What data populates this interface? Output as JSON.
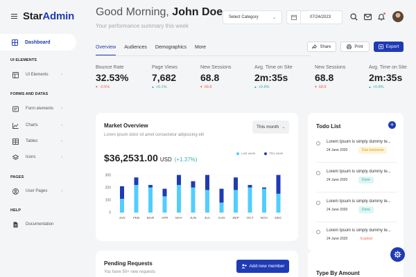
{
  "brand": {
    "part1": "Star",
    "part2": "Admin"
  },
  "sidebar": {
    "active": {
      "label": "Dashboard",
      "icon": "grid-icon"
    },
    "sections": [
      {
        "title": "UI ELEMENTS",
        "items": [
          {
            "label": "UI Elements",
            "icon": "layout-icon",
            "chevron": true
          }
        ]
      },
      {
        "title": "FORMS AND DATAS",
        "items": [
          {
            "label": "Form elements",
            "icon": "card-text-icon",
            "chevron": true
          },
          {
            "label": "Charts",
            "icon": "chart-line-icon",
            "chevron": true
          },
          {
            "label": "Tables",
            "icon": "table-icon",
            "chevron": true
          },
          {
            "label": "Icons",
            "icon": "layers-icon",
            "chevron": true
          }
        ]
      },
      {
        "title": "PAGES",
        "items": [
          {
            "label": "User Pages",
            "icon": "user-icon",
            "chevron": true
          }
        ]
      },
      {
        "title": "HELP",
        "items": [
          {
            "label": "Documentation",
            "icon": "file-icon",
            "chevron": false
          }
        ]
      }
    ]
  },
  "header": {
    "greeting": "Good Morning,",
    "name": "John Doe",
    "subtitle": "Your performance summary this week",
    "category_select": "Select Category",
    "date": "07/24/2023"
  },
  "tabs": [
    "Overview",
    "Audiences",
    "Demographics",
    "More"
  ],
  "actions": {
    "share": "Share",
    "print": "Print",
    "export": "Export"
  },
  "stats": [
    {
      "label": "Bounce Rate",
      "value": "32.53%",
      "change": "-0.5%",
      "dir": "down"
    },
    {
      "label": "Page Views",
      "value": "7,682",
      "change": "+0.1%",
      "dir": "up"
    },
    {
      "label": "New Sessions",
      "value": "68.8",
      "change": "68.8",
      "dir": "down"
    },
    {
      "label": "Avg. Time on Site",
      "value": "2m:35s",
      "change": "+0.8%",
      "dir": "up"
    },
    {
      "label": "New Sessions",
      "value": "68.8",
      "change": "68.8",
      "dir": "down"
    },
    {
      "label": "Avg. Time on Site",
      "value": "2m:35s",
      "change": "+0.8%",
      "dir": "up"
    }
  ],
  "market": {
    "title": "Market Overview",
    "subtitle": "Lorem ipsum dolor sit amet consectetur adipisicing elit",
    "period": "This month",
    "amount": "$36,2531.00",
    "currency": "USD",
    "change": "(+1.37%)"
  },
  "chart_data": {
    "type": "bar",
    "stacked": true,
    "categories": [
      "JAN",
      "FEB",
      "MAR",
      "APR",
      "MAY",
      "JUN",
      "JUL",
      "AUG",
      "SEP",
      "OCT",
      "NOV",
      "DEC"
    ],
    "series": [
      {
        "name": "Last week",
        "color": "#52cdff",
        "values": [
          110,
          220,
          200,
          130,
          220,
          200,
          180,
          80,
          180,
          200,
          190,
          150
        ]
      },
      {
        "name": "This week",
        "color": "#1f3bb3",
        "values": [
          100,
          60,
          20,
          60,
          80,
          50,
          120,
          110,
          100,
          20,
          10,
          150
        ]
      }
    ],
    "yticks": [
      0,
      100,
      200,
      300
    ],
    "ylim": [
      0,
      320
    ],
    "grid": true,
    "legend": "top-right"
  },
  "todo": {
    "title": "Todo List",
    "items": [
      {
        "text": "Lorem Ipsum is simply dummy te...",
        "date": "24 June 2020",
        "badge": "Due tomorrow",
        "kind": "warn"
      },
      {
        "text": "Lorem Ipsum is simply dummy te...",
        "date": "24 June 2020",
        "badge": "Done",
        "kind": "ok"
      },
      {
        "text": "Lorem Ipsum is simply dummy te...",
        "date": "24 June 2020",
        "badge": "Done",
        "kind": "ok"
      },
      {
        "text": "Lorem Ipsum is simply dummy te...",
        "date": "24 June 2020",
        "badge": "Expired",
        "kind": "danger"
      }
    ]
  },
  "pending": {
    "title": "Pending Requests",
    "subtitle": "You have 50+ new requests",
    "button": "Add new member"
  },
  "type_by_amount": {
    "title": "Type By Amount"
  },
  "colors": {
    "primary": "#1f3bb3",
    "light_blue": "#52cdff",
    "success": "#34b1aa",
    "danger": "#f95f53"
  }
}
